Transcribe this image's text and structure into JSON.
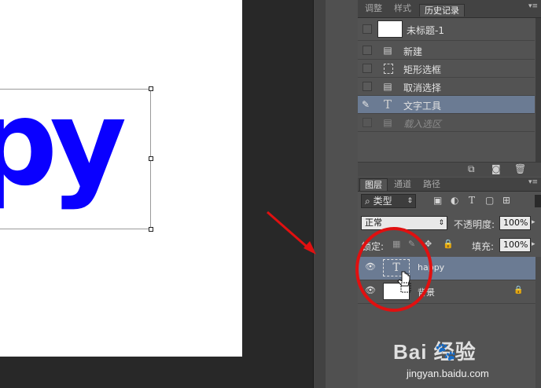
{
  "document": {
    "text_fragment": "py",
    "text_color": "#0a00ff"
  },
  "history_panel": {
    "tabs": [
      {
        "label": "调整",
        "active": false
      },
      {
        "label": "样式",
        "active": false
      },
      {
        "label": "历史记录",
        "active": true
      }
    ],
    "snapshot_label": "未标题-1",
    "items": [
      {
        "label": "新建",
        "icon": "document-icon",
        "selected": false,
        "dim": false
      },
      {
        "label": "矩形选框",
        "icon": "marquee-icon",
        "selected": false,
        "dim": false
      },
      {
        "label": "取消选择",
        "icon": "document-icon",
        "selected": false,
        "dim": false
      },
      {
        "label": "文字工具",
        "icon": "type-icon",
        "selected": true,
        "dim": false
      },
      {
        "label": "载入选区",
        "icon": "document-icon",
        "selected": false,
        "dim": true
      }
    ]
  },
  "layers_panel": {
    "tabs": [
      {
        "label": "图层",
        "active": true
      },
      {
        "label": "通道",
        "active": false
      },
      {
        "label": "路径",
        "active": false
      }
    ],
    "filter_label": "类型",
    "blend_mode": "正常",
    "opacity_label": "不透明度:",
    "opacity_value": "100%",
    "lock_label": "锁定:",
    "fill_label": "填充:",
    "fill_value": "100%",
    "layers": [
      {
        "name": "happy",
        "type": "text",
        "selected": true
      },
      {
        "name": "背景",
        "type": "background",
        "selected": false,
        "locked": true
      }
    ]
  },
  "watermark": {
    "brand": "Bai  经验",
    "url": "jingyan.baidu.com"
  },
  "annotation": {
    "arrow_color": "#e01010",
    "circle_color": "#e01010"
  }
}
